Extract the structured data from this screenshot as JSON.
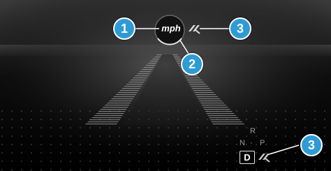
{
  "speed_display": {
    "unit": "mph"
  },
  "transmission": {
    "gears": [
      "R",
      "N",
      "P"
    ],
    "separator": "·",
    "selected": "D"
  },
  "icons": {
    "assist_top": "steering-assist-icon",
    "assist_bottom": "steering-assist-icon"
  },
  "callouts": [
    "1",
    "2",
    "3",
    "3"
  ],
  "colors": {
    "callout": "#2e9bd5",
    "background": "#1a1a1a"
  }
}
